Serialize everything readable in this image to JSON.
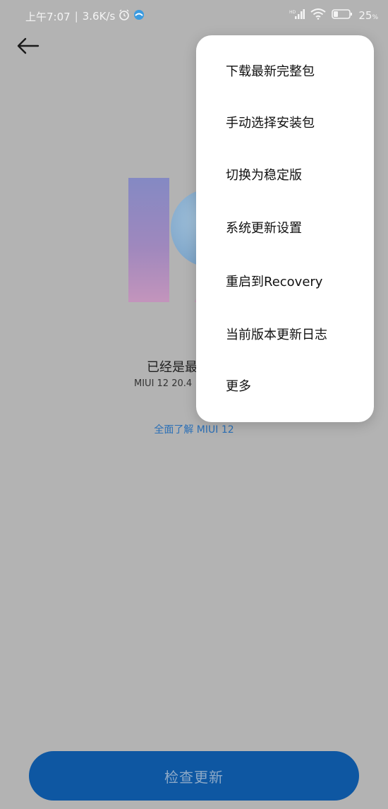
{
  "status_bar": {
    "time": "上午7:07",
    "speed": "3.6K/s",
    "battery": "25",
    "battery_unit": "%"
  },
  "main": {
    "status_title": "已经是最",
    "version_text": "MIUI 12 20.4",
    "learn_more": "全面了解 MIUI 12"
  },
  "menu": {
    "items": [
      {
        "label": "下载最新完整包"
      },
      {
        "label": "手动选择安装包"
      },
      {
        "label": "切换为稳定版"
      },
      {
        "label": "系统更新设置"
      },
      {
        "label": "重启到Recovery"
      },
      {
        "label": "当前版本更新日志"
      },
      {
        "label": "更多"
      }
    ]
  },
  "bottom": {
    "check_update": "检查更新"
  }
}
